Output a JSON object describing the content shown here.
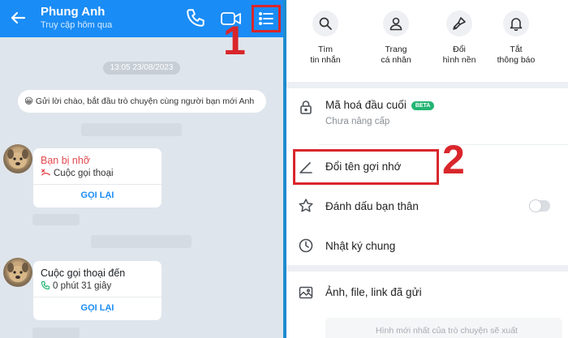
{
  "chat": {
    "contact_name": "Phung Anh",
    "status": "Truy cập hôm qua",
    "timestamp": "13:05 23/08/2023",
    "greeting": "😀 Gửi lời chào, bắt đầu trò chuyện cùng người bạn mới Anh",
    "cards": [
      {
        "title": "Bạn bị nhỡ",
        "detail": "Cuộc gọi thoại",
        "action": "GỌI LẠI",
        "title_color": "#e5484d",
        "detail_icon": "missed-call-icon"
      },
      {
        "title": "Cuộc gọi thoại đến",
        "detail": "0 phút 31 giây",
        "action": "GỌI LẠI",
        "title_color": "#1b1f24",
        "detail_icon": "incoming-call-icon"
      }
    ]
  },
  "markers": {
    "first": "1",
    "second": "2"
  },
  "options": {
    "quick_actions": [
      {
        "line1": "Tìm",
        "line2": "tin nhắn",
        "icon": "search-icon"
      },
      {
        "line1": "Trang",
        "line2": "cá nhân",
        "icon": "user-icon"
      },
      {
        "line1": "Đổi",
        "line2": "hình nền",
        "icon": "brush-icon"
      },
      {
        "line1": "Tắt",
        "line2": "thông báo",
        "icon": "bell-icon"
      }
    ],
    "encryption": {
      "label": "Mã hoá đầu cuối",
      "badge": "BETA",
      "sub": "Chưa nâng cấp",
      "icon": "lock-icon"
    },
    "rename": {
      "label": "Đổi tên gợi nhớ",
      "icon": "pencil-icon"
    },
    "best_friend": {
      "label": "Đánh dấu bạn thân",
      "icon": "star-icon",
      "enabled": false
    },
    "timeline": {
      "label": "Nhật ký chung",
      "icon": "clock-icon"
    },
    "media": {
      "label": "Ảnh, file, link đã gửi",
      "icon": "image-icon",
      "hint": "Hình mới nhất của trò chuyện sẽ xuất"
    }
  },
  "colors": {
    "header_blue": "#1a8cf5",
    "highlight_red": "#d9262b",
    "beta_green": "#22b573",
    "chat_bg": "#dfe5ec"
  }
}
